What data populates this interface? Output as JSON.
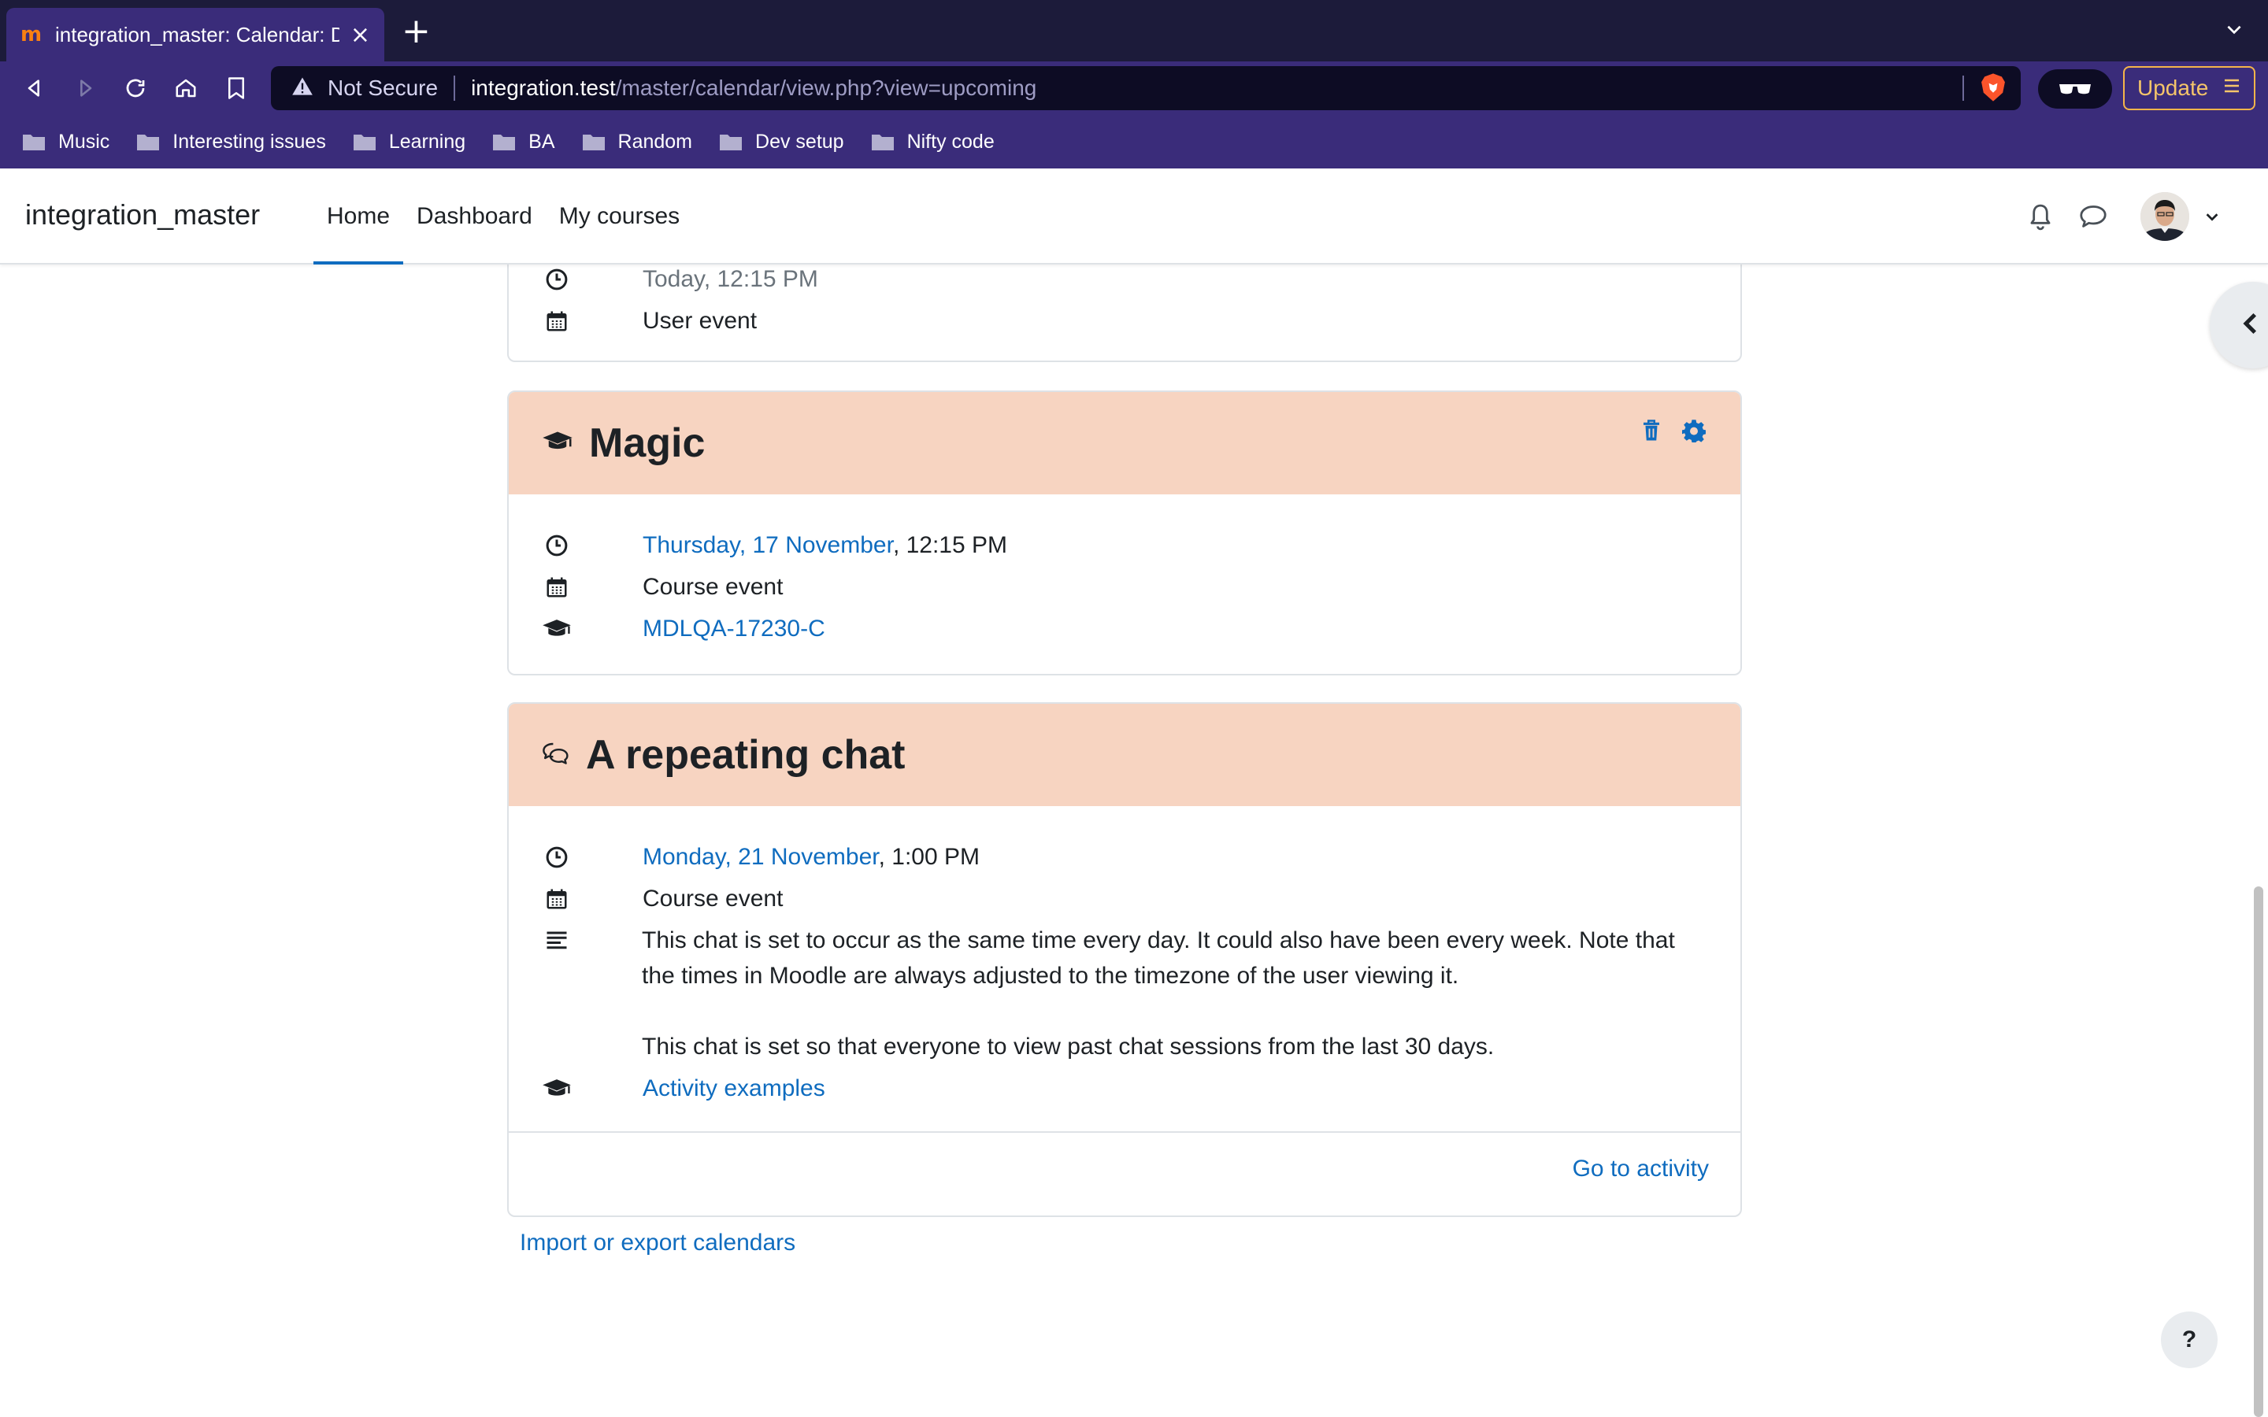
{
  "browser": {
    "tab_title": "integration_master: Calendar: D",
    "tab_favicon": "m",
    "tab_close": "×",
    "new_tab": "+",
    "security_label": "Not Secure",
    "url_host": "integration.test",
    "url_path": "/master/calendar/view.php?view=upcoming",
    "update_label": "Update",
    "bookmarks": [
      "Music",
      "Interesting issues",
      "Learning",
      "BA",
      "Random",
      "Dev setup",
      "Nifty code"
    ]
  },
  "navbar": {
    "site_name": "integration_master",
    "items": [
      "Home",
      "Dashboard",
      "My courses"
    ],
    "active": "Home"
  },
  "events": [
    {
      "time": "Today, 12:15 PM",
      "type": "User event"
    },
    {
      "title": "Magic",
      "date_link": "Thursday, 17 November",
      "time": ", 12:15 PM",
      "type": "Course event",
      "course": "MDLQA-17230-C"
    },
    {
      "title": "A repeating chat",
      "date_link": "Monday, 21 November",
      "time": ", 1:00 PM",
      "type": "Course event",
      "description": [
        "This chat is set to occur as the same time every day. It could also have been every week. Note that the times in Moodle are always adjusted to the timezone of the user viewing it.",
        "This chat is set so that everyone to view past chat sessions from the last 30 days."
      ],
      "course": "Activity examples",
      "footer_link": "Go to activity"
    }
  ],
  "import_export_link": "Import or export calendars",
  "help_label": "?",
  "colors": {
    "browser_tabstrip": "#1c1b3a",
    "browser_toolbar": "#3a2c7a",
    "card_header": "#f7d4c1",
    "link": "#0f6cbf",
    "nav_active_underline": "#0f6cbf"
  },
  "icons": [
    "back-icon",
    "forward-icon",
    "reload-icon",
    "home-icon",
    "bookmark-icon",
    "warning-icon",
    "brave-lion-icon",
    "glasses-icon",
    "menu-icon",
    "folder-icon",
    "bell-icon",
    "chat-bubble-icon",
    "chevron-down-icon",
    "clock-icon",
    "calendar-icon",
    "graduation-cap-icon",
    "trash-icon",
    "gear-icon",
    "chat-icon",
    "description-icon",
    "chevron-left-icon"
  ]
}
